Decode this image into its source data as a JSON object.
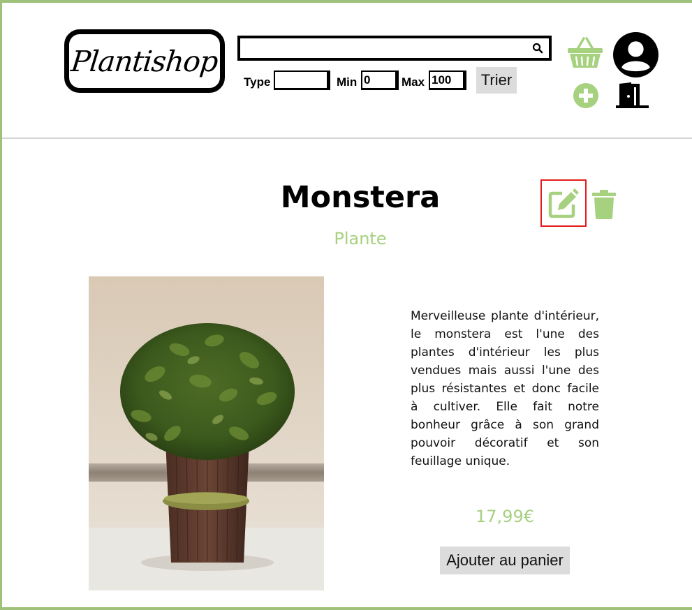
{
  "header": {
    "logo_text": "Plantishop",
    "search": {
      "value": "",
      "placeholder": ""
    },
    "filters": {
      "type_label": "Type",
      "type_value": "",
      "min_label": "Min",
      "min_value": "0",
      "max_label": "Max",
      "max_value": "100",
      "sort_button": "Trier"
    },
    "icons": [
      "basket-icon",
      "user-account-icon",
      "add-icon",
      "logout-door-icon"
    ]
  },
  "product": {
    "name": "Monstera",
    "category": "Plante",
    "description": "Merveilleuse plante d'intérieur, le monstera est l'une des plantes d'intérieur les plus vendues mais aussi l'une des plus résistantes et donc facile à cultiver. Elle fait notre bonheur grâce à son grand pouvoir décoratif et son feuillage unique.",
    "price": "17,99€",
    "add_to_cart": "Ajouter au panier",
    "actions": [
      "edit-icon",
      "trash-icon"
    ]
  },
  "colors": {
    "accent_green": "#a6d17f",
    "frame_green": "#9fc17a",
    "highlight_red": "#e31b1b"
  }
}
